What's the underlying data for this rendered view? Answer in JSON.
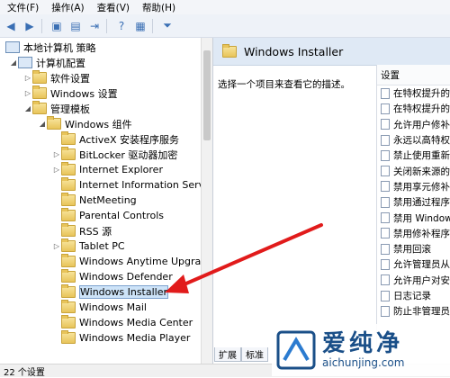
{
  "menu": [
    "文件(F)",
    "操作(A)",
    "查看(V)",
    "帮助(H)"
  ],
  "tree": {
    "root": "本地计算机 策略",
    "computer_config": "计算机配置",
    "software": "软件设置",
    "windows_settings": "Windows 设置",
    "admin_templates": "管理模板",
    "windows_components": "Windows 组件",
    "items": [
      "ActiveX 安装程序服务",
      "BitLocker 驱动器加密",
      "Internet Explorer",
      "Internet Information Servi",
      "NetMeeting",
      "Parental Controls",
      "RSS 源",
      "Tablet PC",
      "Windows Anytime Upgrac",
      "Windows Defender",
      "Windows Installer",
      "Windows Mail",
      "Windows Media Center",
      "Windows Media Player"
    ],
    "selected": "Windows Installer"
  },
  "right": {
    "title": "Windows Installer",
    "description": "选择一个项目来查看它的描述。",
    "column_header": "设置",
    "settings": [
      "在特权提升的",
      "在特权提升的",
      "允许用户修补",
      "永远以高特权",
      "禁止使用重新",
      "关闭新来源的",
      "禁用享元修补",
      "禁用通过程序",
      "禁用 Window",
      "禁用修补程序",
      "禁用回滚",
      "允许管理员从",
      "允许用户对安",
      "日志记录",
      "防止非管理员"
    ]
  },
  "tabs": [
    "扩展",
    "标准"
  ],
  "status": "22 个设置",
  "watermark": {
    "cn": "爱纯净",
    "url": "aichunjing.com"
  }
}
